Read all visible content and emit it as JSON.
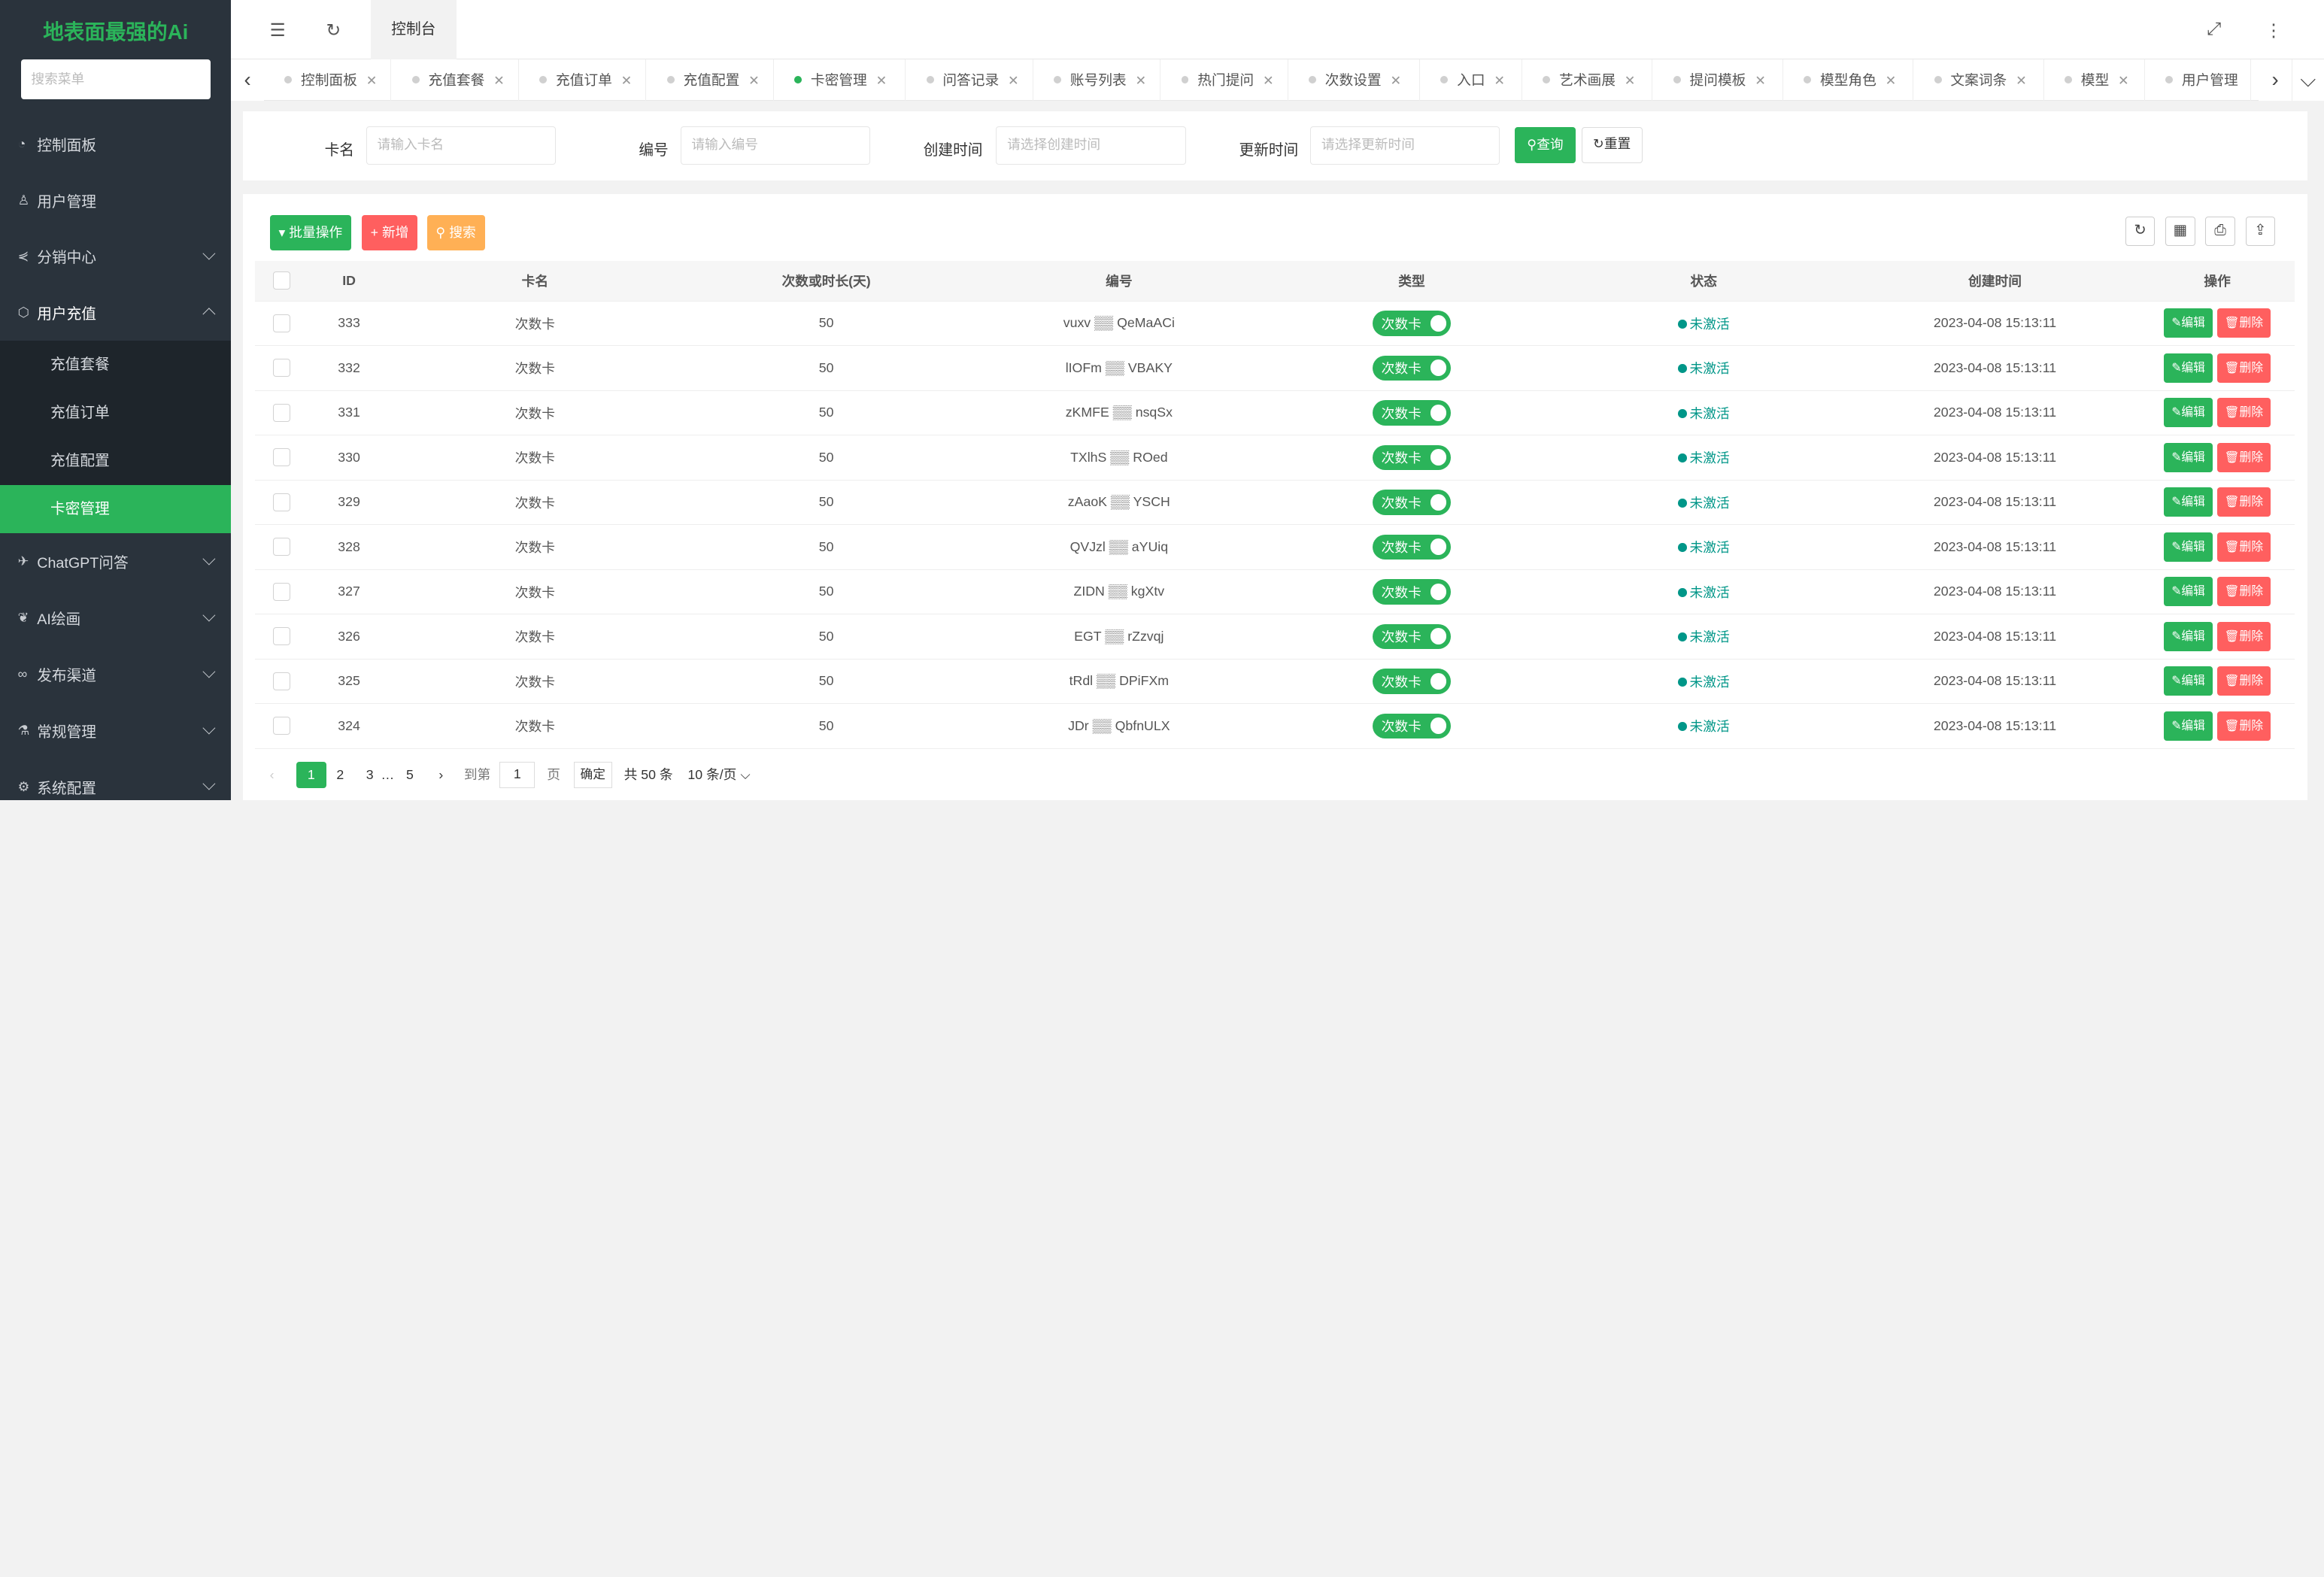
{
  "sidebar": {
    "logo": "地表面最强的Ai",
    "search_placeholder": "搜索菜单",
    "items": [
      {
        "label": "控制面板",
        "icon": "◔"
      },
      {
        "label": "用户管理",
        "icon": "♙"
      },
      {
        "label": "分销中心",
        "icon": "⋞"
      },
      {
        "label": "用户充值",
        "icon": "⬡"
      },
      {
        "label": "ChatGPT问答",
        "icon": "✈"
      },
      {
        "label": "AI绘画",
        "icon": "❦"
      },
      {
        "label": "发布渠道",
        "icon": "∞"
      },
      {
        "label": "常规管理",
        "icon": "⚗"
      },
      {
        "label": "系统配置",
        "icon": "⚙"
      }
    ],
    "subitems": [
      "充值套餐",
      "充值订单",
      "充值配置",
      "卡密管理"
    ]
  },
  "topbar": {
    "current_tab": "控制台",
    "icons": {
      "collapse": "☰",
      "refresh": "↻",
      "fullscreen": "⤢",
      "more": "⋮"
    }
  },
  "tabs": [
    "控制面板",
    "充值套餐",
    "充值订单",
    "充值配置",
    "卡密管理",
    "问答记录",
    "账号列表",
    "热门提问",
    "次数设置",
    "入口",
    "艺术画展",
    "提问模板",
    "模型角色",
    "文案词条",
    "模型",
    "用户管理"
  ],
  "search": {
    "fields": [
      {
        "label": "卡名",
        "placeholder": "请输入卡名"
      },
      {
        "label": "编号",
        "placeholder": "请输入编号"
      },
      {
        "label": "创建时间",
        "placeholder": "请选择创建时间"
      },
      {
        "label": "更新时间",
        "placeholder": "请选择更新时间"
      }
    ],
    "query": "查询",
    "reset": "重置"
  },
  "toolbar": {
    "batch": "批量操作",
    "add": "新增",
    "search": "搜索"
  },
  "table": {
    "headers": [
      "ID",
      "卡名",
      "次数或时长(天)",
      "编号",
      "类型",
      "状态",
      "创建时间",
      "操作"
    ],
    "rows": [
      {
        "id": "333",
        "name": "次数卡",
        "count": "50",
        "code": "vuxv ▒▒ QeMaACi",
        "type": "次数卡",
        "status": "未激活",
        "created": "2023-04-08 15:13:11"
      },
      {
        "id": "332",
        "name": "次数卡",
        "count": "50",
        "code": "lIOFm ▒▒ VBAKY",
        "type": "次数卡",
        "status": "未激活",
        "created": "2023-04-08 15:13:11"
      },
      {
        "id": "331",
        "name": "次数卡",
        "count": "50",
        "code": "zKMFE ▒▒ nsqSx",
        "type": "次数卡",
        "status": "未激活",
        "created": "2023-04-08 15:13:11"
      },
      {
        "id": "330",
        "name": "次数卡",
        "count": "50",
        "code": "TXlhS ▒▒ ROed",
        "type": "次数卡",
        "status": "未激活",
        "created": "2023-04-08 15:13:11"
      },
      {
        "id": "329",
        "name": "次数卡",
        "count": "50",
        "code": "zAaoK ▒▒ YSCH",
        "type": "次数卡",
        "status": "未激活",
        "created": "2023-04-08 15:13:11"
      },
      {
        "id": "328",
        "name": "次数卡",
        "count": "50",
        "code": "QVJzl ▒▒ aYUiq",
        "type": "次数卡",
        "status": "未激活",
        "created": "2023-04-08 15:13:11"
      },
      {
        "id": "327",
        "name": "次数卡",
        "count": "50",
        "code": "ZIDN ▒▒ kgXtv",
        "type": "次数卡",
        "status": "未激活",
        "created": "2023-04-08 15:13:11"
      },
      {
        "id": "326",
        "name": "次数卡",
        "count": "50",
        "code": "EGT ▒▒ rZzvqj",
        "type": "次数卡",
        "status": "未激活",
        "created": "2023-04-08 15:13:11"
      },
      {
        "id": "325",
        "name": "次数卡",
        "count": "50",
        "code": "tRdl ▒▒ DPiFXm",
        "type": "次数卡",
        "status": "未激活",
        "created": "2023-04-08 15:13:11"
      },
      {
        "id": "324",
        "name": "次数卡",
        "count": "50",
        "code": "JDr ▒▒ QbfnULX",
        "type": "次数卡",
        "status": "未激活",
        "created": "2023-04-08 15:13:11"
      }
    ],
    "edit": "编辑",
    "delete": "删除"
  },
  "pager": {
    "pages": [
      "1",
      "2",
      "3",
      "…",
      "5"
    ],
    "goto": "到第",
    "page_value": "1",
    "page_unit": "页",
    "confirm": "确定",
    "total": "共 50 条",
    "size": "10 条/页"
  },
  "colors": {
    "accent": "#2bb45a",
    "danger": "#ff5f5f",
    "warning": "#ffb055",
    "status": "#009688",
    "sidebar": "#2a333c"
  }
}
